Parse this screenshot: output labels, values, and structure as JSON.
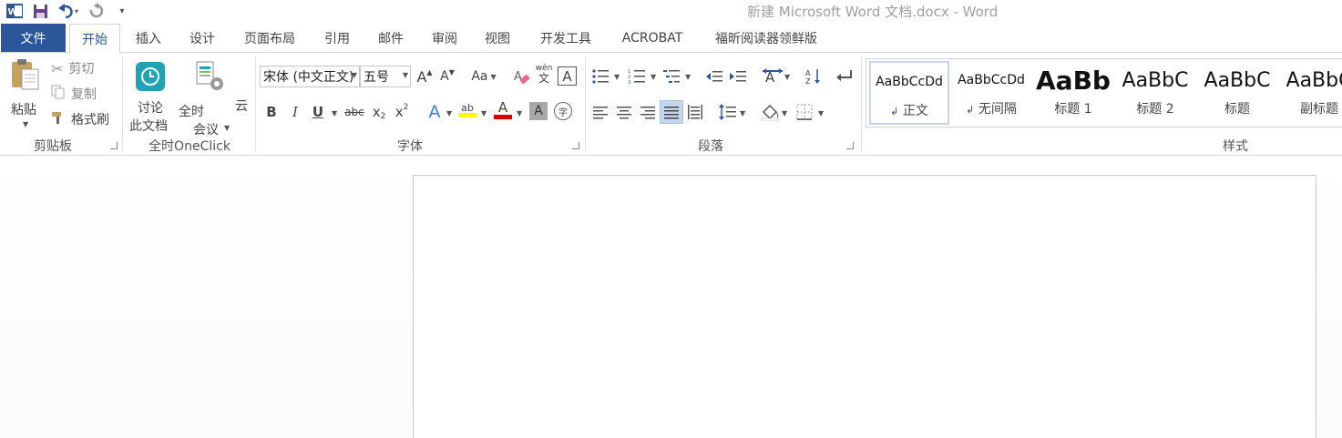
{
  "window": {
    "title": "新建 Microsoft Word 文档.docx - Word"
  },
  "qat": {
    "icons": [
      "word-app-icon",
      "save-icon",
      "undo-icon",
      "redo-icon",
      "customize-icon"
    ],
    "undo_caret": "▾",
    "customize_glyph": "▾"
  },
  "tabs": {
    "file": "文件",
    "items": [
      "开始",
      "插入",
      "设计",
      "页面布局",
      "引用",
      "邮件",
      "审阅",
      "视图",
      "开发工具",
      "ACROBAT",
      "福昕阅读器领鲜版"
    ],
    "active": "开始"
  },
  "clipboard": {
    "paste_label": "粘贴",
    "cut_label": "剪切",
    "copy_label": "复制",
    "format_painter_label": "格式刷",
    "group_label": "剪贴板"
  },
  "oneclick": {
    "discuss_line1": "讨论",
    "discuss_line2": "此文档",
    "meeting_line1": "全时",
    "meeting_line2": "会议",
    "cloud_label": "云",
    "group_label": "全时OneClick"
  },
  "font": {
    "font_name": "宋体 (中文正文)",
    "font_size": "五号",
    "grow_glyph": "A",
    "shrink_glyph": "A",
    "case_glyph": "Aa",
    "phonetic_top": "wén",
    "phonetic_bottom": "文",
    "border_glyph": "A",
    "bold": "B",
    "italic": "I",
    "underline": "U",
    "strike": "abc",
    "sub_base": "x",
    "sub_mark": "2",
    "sup_base": "x",
    "sup_mark": "2",
    "effect_glyph": "A",
    "highlight_glyph": "ab",
    "color_glyph": "A",
    "shade_glyph": "A",
    "enclose_glyph": "字",
    "highlight_color": "#ffff00",
    "font_color": "#e00000",
    "group_label": "字体"
  },
  "paragraph": {
    "group_label": "段落"
  },
  "styles": {
    "group_label": "样式",
    "items": [
      {
        "preview": "AaBbCcDd",
        "name": "正文",
        "mark": "↲",
        "selected": true
      },
      {
        "preview": "AaBbCcDd",
        "name": "无间隔",
        "mark": "↲",
        "selected": false
      },
      {
        "preview": "AaBb",
        "name": "标题 1",
        "mark": "",
        "selected": false
      },
      {
        "preview": "AaBbC",
        "name": "标题 2",
        "mark": "",
        "selected": false
      },
      {
        "preview": "AaBbC",
        "name": "标题",
        "mark": "",
        "selected": false
      },
      {
        "preview": "AaBbC",
        "name": "副标题",
        "mark": "",
        "selected": false
      }
    ]
  },
  "colors": {
    "accent": "#2b579a",
    "oneclick_teal": "#21a3b5"
  }
}
